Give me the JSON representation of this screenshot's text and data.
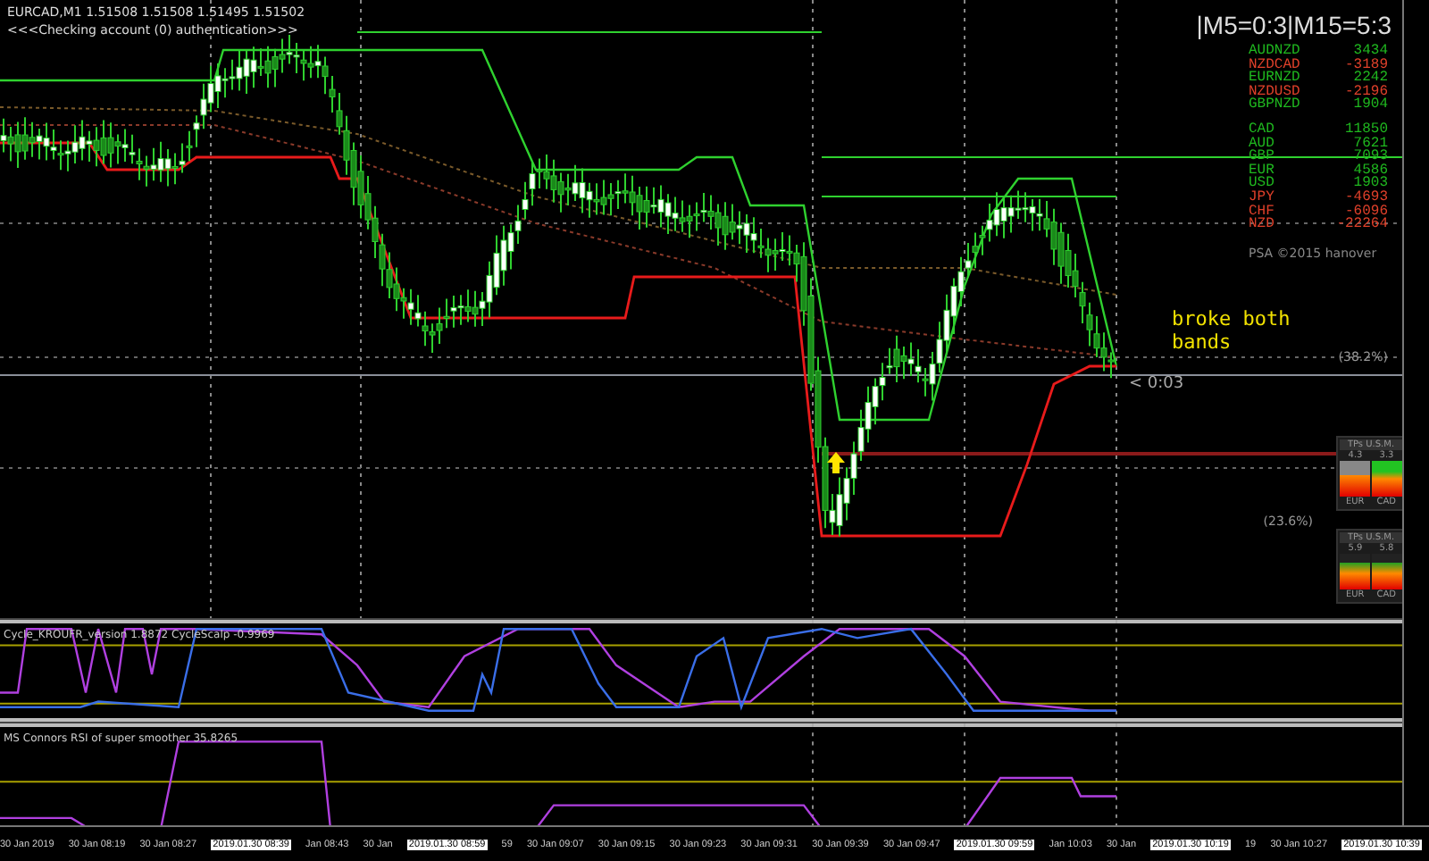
{
  "chart": {
    "symbol_line": "EURCAD,M1  1.51508 1.51508 1.51495 1.51502",
    "status": "<<<Checking account (0) authentication>>>",
    "signal": "|M5=0:3|M15=5:3",
    "pairs": [
      {
        "name": "AUDNZD",
        "value": "3434",
        "color": "#1fb81f"
      },
      {
        "name": "NZDCAD",
        "value": "-3189",
        "color": "#e0402a"
      },
      {
        "name": "EURNZD",
        "value": "2242",
        "color": "#1fb81f"
      },
      {
        "name": "NZDUSD",
        "value": "-2196",
        "color": "#e0402a"
      },
      {
        "name": "GBPNZD",
        "value": "1904",
        "color": "#1fb81f"
      }
    ],
    "currencies": [
      {
        "name": "CAD",
        "value": "11850",
        "color": "#1fb81f"
      },
      {
        "name": "AUD",
        "value": "7621",
        "color": "#1fb81f"
      },
      {
        "name": "GBP",
        "value": "7093",
        "color": "#1fb81f"
      },
      {
        "name": "EUR",
        "value": "4586",
        "color": "#1fb81f"
      },
      {
        "name": "USD",
        "value": "1903",
        "color": "#1fb81f"
      },
      {
        "name": "JPY",
        "value": "-4693",
        "color": "#e0402a"
      },
      {
        "name": "CHF",
        "value": "-6096",
        "color": "#e0402a"
      },
      {
        "name": "NZD",
        "value": "-22264",
        "color": "#e0402a"
      }
    ],
    "credit": "PSA ©2015 hanover",
    "fib_levels": [
      "(38.2%)",
      "(23.6%)"
    ],
    "countdown": "< 0:03",
    "annotation": "broke both bands",
    "meters": [
      {
        "title": "TPs U.S.M.",
        "values": [
          "4.3",
          "3.3"
        ],
        "labels": [
          "EUR",
          "CAD"
        ]
      },
      {
        "title": "TPs U.S.M.",
        "values": [
          "5.9",
          "5.8"
        ],
        "labels": [
          "EUR",
          "CAD"
        ]
      }
    ]
  },
  "indicators": [
    {
      "kind": "cycle",
      "label": "Cycle_KROUFR_version 1.8872  CycleScalp -0.9969"
    },
    {
      "kind": "rsi",
      "label": "MS Connors RSI of super smoother 35.8265"
    }
  ],
  "time_axis": [
    {
      "kind": "tick",
      "label": "30 Jan 2019"
    },
    {
      "kind": "tick",
      "label": "30 Jan 08:19"
    },
    {
      "kind": "tick",
      "label": "30 Jan 08:27"
    },
    {
      "kind": "cursor",
      "label": "2019.01.30 08:39"
    },
    {
      "kind": "tick",
      "label": "Jan 08:43"
    },
    {
      "kind": "tick",
      "label": "30 Jan"
    },
    {
      "kind": "cursor",
      "label": "2019.01.30 08:59"
    },
    {
      "kind": "tick",
      "label": "59"
    },
    {
      "kind": "tick",
      "label": "30 Jan 09:07"
    },
    {
      "kind": "tick",
      "label": "30 Jan 09:15"
    },
    {
      "kind": "tick",
      "label": "30 Jan 09:23"
    },
    {
      "kind": "tick",
      "label": "30 Jan 09:31"
    },
    {
      "kind": "tick",
      "label": "30 Jan 09:39"
    },
    {
      "kind": "tick",
      "label": "30 Jan 09:47"
    },
    {
      "kind": "cursor",
      "label": "2019.01.30 09:59"
    },
    {
      "kind": "tick",
      "label": "Jan 10:03"
    },
    {
      "kind": "tick",
      "label": "30 Jan"
    },
    {
      "kind": "cursor",
      "label": "2019.01.30 10:19"
    },
    {
      "kind": "tick",
      "label": "19"
    },
    {
      "kind": "tick",
      "label": "30 Jan 10:27"
    },
    {
      "kind": "cursor",
      "label": "2019.01.30 10:39"
    }
  ]
}
